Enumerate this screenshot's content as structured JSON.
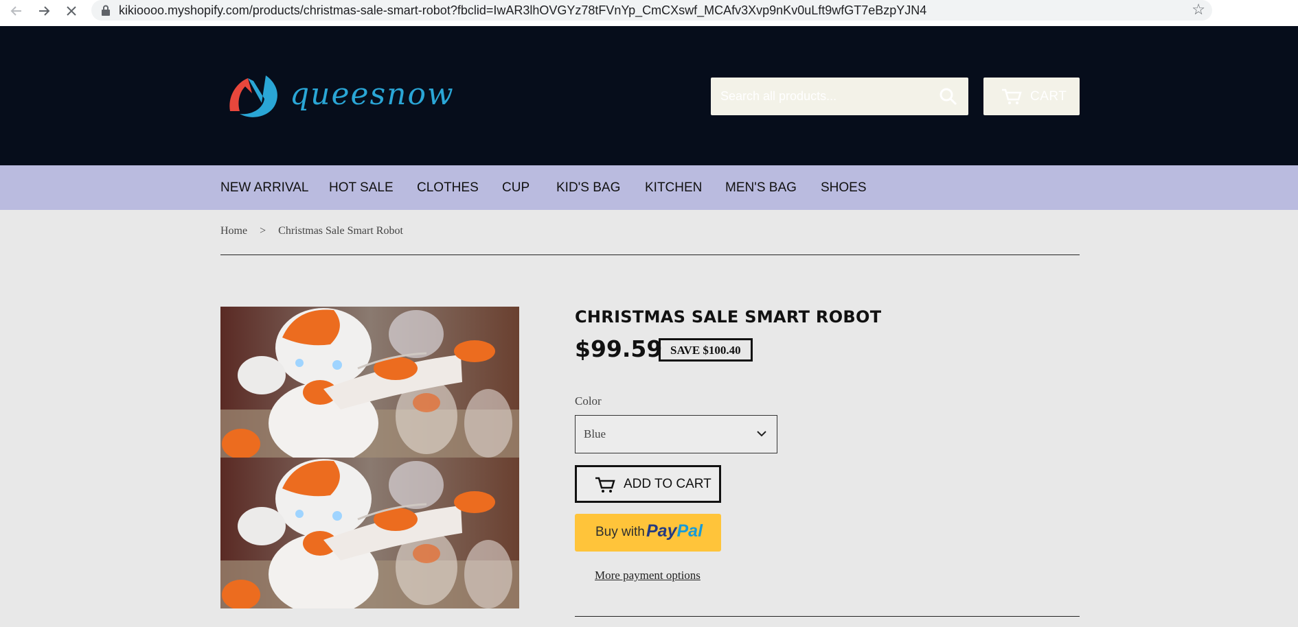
{
  "browser": {
    "back_icon": "arrow-left-icon",
    "forward_icon": "arrow-right-icon",
    "stop_icon": "close-icon",
    "url": "kikioooo.myshopify.com/products/christmas-sale-smart-robot?fbclid=IwAR3lhOVGYz78tFVnYp_CmCXswf_MCAfv3Xvp9nKv0uLft9wfGT7eBzpYJN4",
    "star_icon": "star-icon"
  },
  "header": {
    "logo_text": "queesnow",
    "search_placeholder": "Search all products...",
    "cart_label": "CART",
    "background": "#060d1b",
    "input_bg": "#f3f2e8"
  },
  "menu": {
    "background": "#babbdf",
    "items": [
      "NEW ARRIVAL",
      "HOT SALE",
      "CLOTHES",
      "CUP",
      "KID'S BAG",
      "KITCHEN",
      "MEN'S BAG",
      "SHOES"
    ]
  },
  "breadcrumb": {
    "home": "Home",
    "separator": ">",
    "current": "Christmas Sale Smart Robot"
  },
  "product": {
    "title": "CHRISTMAS SALE SMART ROBOT",
    "price": "$99.59",
    "save_badge": "SAVE $100.40",
    "color_label": "Color",
    "color_value": "Blue",
    "add_to_cart": "ADD TO CART",
    "paypal_prefix": "Buy with",
    "paypal_brand_1": "Pay",
    "paypal_brand_2": "Pal",
    "more_payment": "More payment options",
    "paypal_color": "#ffc43a"
  }
}
